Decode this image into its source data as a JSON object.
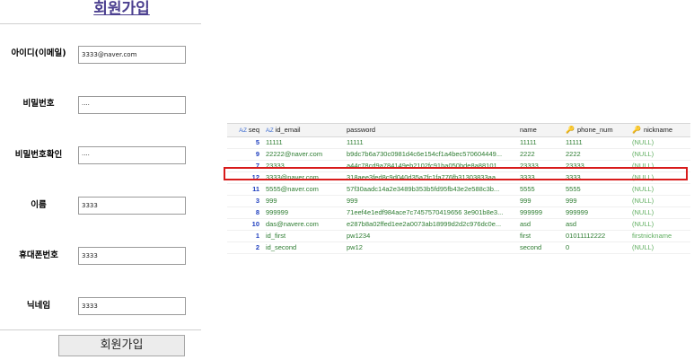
{
  "form": {
    "title": "회원가입",
    "submit_label": "회원가입",
    "fields": [
      {
        "label": "아이디(이메일)",
        "value": "3333@naver.com"
      },
      {
        "label": "비밀번호",
        "value": "····"
      },
      {
        "label": "비밀번호확인",
        "value": "····"
      },
      {
        "label": "이름",
        "value": "3333"
      },
      {
        "label": "휴대폰번호",
        "value": "3333"
      },
      {
        "label": "닉네임",
        "value": "3333"
      }
    ]
  },
  "table": {
    "columns": [
      "seq",
      "id_email",
      "password",
      "name",
      "phone_num",
      "nickname"
    ],
    "rows": [
      {
        "seq": "5",
        "id_email": "11111",
        "password": "11111",
        "name": "11111",
        "phone_num": "11111",
        "nickname": "(NULL)"
      },
      {
        "seq": "9",
        "id_email": "22222@naver.com",
        "password": "b9dc7b6a730c0981d4c6e154cf1a4bec570604449...",
        "name": "2222",
        "phone_num": "2222",
        "nickname": "(NULL)"
      },
      {
        "seq": "7",
        "id_email": "23333",
        "password": "a44c78cd9a784149eb2102fc91ba050bde8a88101...",
        "name": "23333",
        "phone_num": "23333",
        "nickname": "(NULL)"
      },
      {
        "seq": "12",
        "id_email": "3333@naver.com",
        "password": "318aee3fed8c9d040d35a7fc1fa776fb31303833aa...",
        "name": "3333",
        "phone_num": "3333",
        "nickname": "(NULL)"
      },
      {
        "seq": "11",
        "id_email": "5555@naver.com",
        "password": "57f30aadc14a2e3489b353b5fd95fb43e2e588c3b...",
        "name": "5555",
        "phone_num": "5555",
        "nickname": "(NULL)"
      },
      {
        "seq": "3",
        "id_email": "999",
        "password": "999",
        "name": "999",
        "phone_num": "999",
        "nickname": "(NULL)"
      },
      {
        "seq": "8",
        "id_email": "999999",
        "password": "71eef4e1edf984ace7c7457570419656 3e901b8e3...",
        "name": "999999",
        "phone_num": "999999",
        "nickname": "(NULL)"
      },
      {
        "seq": "10",
        "id_email": "das@navere.com",
        "password": "e287b8a02ffed1ee2a0073ab18999d2d2c976dc0e...",
        "name": "asd",
        "phone_num": "asd",
        "nickname": "(NULL)"
      },
      {
        "seq": "1",
        "id_email": "id_first",
        "password": "pw1234",
        "name": "first",
        "phone_num": "01011112222",
        "nickname": "firstnickname"
      },
      {
        "seq": "2",
        "id_email": "id_second",
        "password": "pw12",
        "name": "second",
        "phone_num": "0",
        "nickname": "(NULL)"
      }
    ]
  }
}
